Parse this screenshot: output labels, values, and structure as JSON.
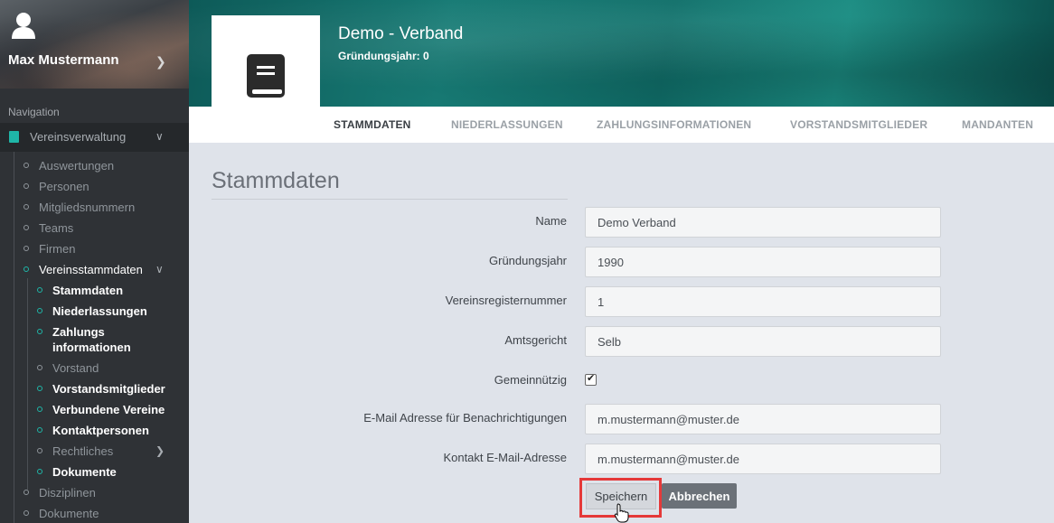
{
  "user": {
    "name": "Max Mustermann"
  },
  "nav": {
    "title": "Navigation",
    "top": "Vereinsverwaltung",
    "items": [
      "Auswertungen",
      "Personen",
      "Mitgliedsnummern",
      "Teams",
      "Firmen",
      "Vereinsstammdaten"
    ],
    "subitems": [
      "Stammdaten",
      "Niederlassungen",
      "Zahlungs",
      "informationen",
      "Vorstand",
      "Vorstandsmitglieder",
      "Verbundene Vereine",
      "Kontaktpersonen",
      "Rechtliches",
      "Dokumente"
    ],
    "bottom": [
      "Disziplinen",
      "Dokumente"
    ]
  },
  "header": {
    "title": "Demo - Verband",
    "subtitle": "Gründungsjahr: 0"
  },
  "tabs": [
    "STAMMDATEN",
    "NIEDERLASSUNGEN",
    "ZAHLUNGSINFORMATIONEN",
    "VORSTANDSMITGLIEDER",
    "MANDANTEN"
  ],
  "form": {
    "title": "Stammdaten",
    "fields": [
      {
        "label": "Name",
        "value": "Demo Verband"
      },
      {
        "label": "Gründungsjahr",
        "value": "1990"
      },
      {
        "label": "Vereinsregisternummer",
        "value": "1"
      },
      {
        "label": "Amtsgericht",
        "value": "Selb"
      },
      {
        "label": "Gemeinnützig",
        "checked": true
      },
      {
        "label": "E-Mail Adresse für Benachrichtigungen",
        "value": "m.mustermann@muster.de"
      },
      {
        "label": "Kontakt E-Mail-Adresse",
        "value": "m.mustermann@muster.de"
      }
    ],
    "save_label": "Speichern",
    "cancel_label": "Abbrechen"
  },
  "colors": {
    "accent": "#1fb6a8",
    "highlight": "#e53939",
    "sidebar": "#2f3236"
  }
}
